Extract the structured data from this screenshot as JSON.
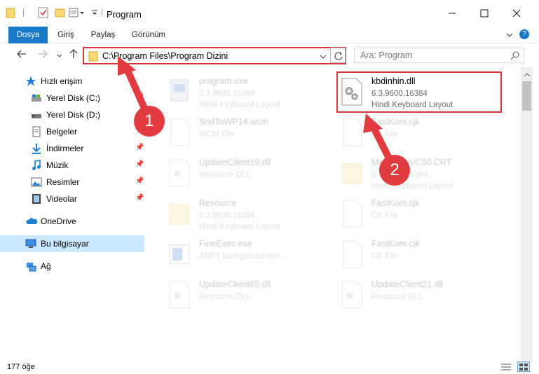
{
  "window": {
    "title": "Program"
  },
  "ribbon": {
    "tabs": [
      "Dosya",
      "Giriş",
      "Paylaş",
      "Görünüm"
    ]
  },
  "address": {
    "path": "C:\\Program Files\\Program Dizini"
  },
  "search": {
    "placeholder": "Ara: Program"
  },
  "sidebar": {
    "items": [
      {
        "label": "Hızlı erişim"
      },
      {
        "label": "Yerel Disk (C:)"
      },
      {
        "label": "Yerel Disk (D:)"
      },
      {
        "label": "Belgeler"
      },
      {
        "label": "İndirmeler"
      },
      {
        "label": "Müzik"
      },
      {
        "label": "Resimler"
      },
      {
        "label": "Videolar"
      },
      {
        "label": "OneDrive"
      },
      {
        "label": "Bu bilgisayar"
      },
      {
        "label": "Ağ"
      }
    ]
  },
  "files": [
    {
      "name": "program.exe",
      "line1": "6.3.9600.16384",
      "line2": "Hindi Keyboard Layout"
    },
    {
      "name": "kbdinhin.dll",
      "line1": "6.3.9600.16384",
      "line2": "Hindi Keyboard Layout"
    },
    {
      "name": "SndToWP14.wcm",
      "line1": "WCM File",
      "line2": ""
    },
    {
      "name": "FastKom.cjk",
      "line1": "CK File",
      "line2": ""
    },
    {
      "name": "UpdateClient19.dll",
      "line1": "Resource DLL",
      "line2": ""
    },
    {
      "name": "Microsoft.VC90.CRT",
      "line1": "6.3.9600.16384",
      "line2": "Hindi Keyboard Layout"
    },
    {
      "name": "Resource",
      "line1": "6.3.9600.16384",
      "line2": "Hindi Keyboard Layout"
    },
    {
      "name": "FastKom.cjk",
      "line1": "CK File",
      "line2": ""
    },
    {
      "name": "FineExec.exe",
      "line1": "ABBY background exe...",
      "line2": ""
    },
    {
      "name": "FastKom.cjk",
      "line1": "CK File",
      "line2": ""
    },
    {
      "name": "UpdateClient65.dll",
      "line1": "Resource DLL",
      "line2": ""
    },
    {
      "name": "UpdateClient21.dll",
      "line1": "Resource DLL",
      "line2": ""
    }
  ],
  "annotations": {
    "badge1": "1",
    "badge2": "2"
  },
  "status": {
    "count": "177 öğe"
  },
  "colors": {
    "accent": "#1979ca",
    "highlight": "#d9363e"
  }
}
